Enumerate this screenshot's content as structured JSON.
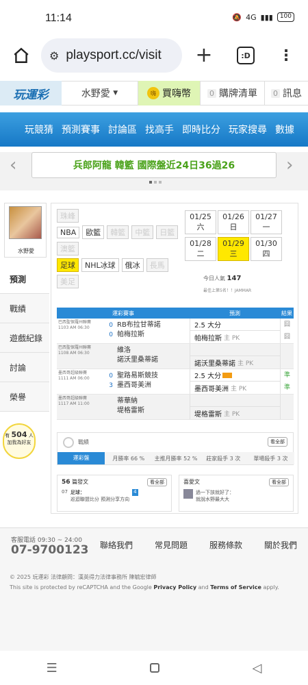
{
  "status": {
    "time": "11:14",
    "signal": "4G",
    "battery": "100"
  },
  "browser": {
    "url": "playsport.cc/visit",
    "tab_count": ":D"
  },
  "site": {
    "logo": "玩運彩",
    "user": "水野愛",
    "buy": "買嗨幣",
    "cart_count": "0",
    "cart": "購牌清單",
    "msg_count": "0",
    "msg": "訊息"
  },
  "nav": [
    "玩競猜",
    "預測賽事",
    "討論區",
    "找高手",
    "即時比分",
    "玩家搜尋",
    "數據"
  ],
  "marquee": {
    "text": "兵郎阿龍 韓籃 國際盤近24日36過26"
  },
  "profile": {
    "name": "水野愛"
  },
  "sidebar": [
    {
      "label": "預測"
    },
    {
      "label": "戰績"
    },
    {
      "label": "遊戲紀錄"
    },
    {
      "label": "討論"
    },
    {
      "label": "榮譽"
    }
  ],
  "bulb": {
    "pre": "有",
    "count": "504",
    "post": "人",
    "sub": "加我為好友"
  },
  "leagues": {
    "row1": [
      "珠峰",
      "NBA",
      "歐籃",
      "韓籃",
      "中籃",
      "日籃",
      "澳籃"
    ],
    "row2": [
      "足球",
      "NHL冰球",
      "俄冰",
      "長馬",
      "美足"
    ]
  },
  "dates": [
    {
      "d": "01/25",
      "w": "六"
    },
    {
      "d": "01/26",
      "w": "日"
    },
    {
      "d": "01/27",
      "w": "一"
    },
    {
      "d": "01/28",
      "w": "二"
    },
    {
      "d": "01/29",
      "w": "三"
    },
    {
      "d": "01/30",
      "w": "四"
    }
  ],
  "visits": {
    "label": "今日人氣",
    "value": "147",
    "rank": "最佳上第5名！！JAMMAR"
  },
  "table": {
    "head": [
      "運彩賽事",
      "預測",
      "結果"
    ],
    "rows": [
      {
        "league": "巴西聖保羅州聯賽",
        "time": "1103 AM 06:30",
        "home": "RB布拉甘蒂諾",
        "away": "帕梅拉斯",
        "hs": "0",
        "as": "0",
        "p1": "2.5 大分",
        "p2": "帕梅拉斯",
        "p2pk": "主 PK",
        "r1": "囧",
        "r2": "囧",
        "grey": false
      },
      {
        "league": "巴西聖保羅州聯賽",
        "time": "1108 AM 06:30",
        "home": "維洛",
        "away": "諾沃里桑蒂諾",
        "hs": "",
        "as": "",
        "p1": "",
        "p2": "諾沃里桑蒂諾",
        "p2pk": "主 PK",
        "r1": "",
        "r2": "",
        "grey": true
      },
      {
        "league": "墨西哥超級聯賽",
        "time": "1111 AM 06:00",
        "home": "聖路易斯競技",
        "away": "墨西哥美洲",
        "hs": "0",
        "as": "3",
        "p1": "2.5 大分",
        "p2": "墨西哥美洲",
        "p2pk": "主 PK",
        "r1": "準",
        "r2": "準",
        "grey": false
      },
      {
        "league": "墨西哥超級聯賽",
        "time": "1117 AM 11:00",
        "home": "蒂華納",
        "away": "堤格雷斯",
        "hs": "",
        "as": "",
        "p1": "",
        "p2": "堤格雷斯",
        "p2pk": "主 PK",
        "r1": "",
        "r2": "",
        "grey": true
      }
    ]
  },
  "stats": {
    "title": "戰績",
    "more": "看全部",
    "items": [
      "運彩盤",
      "月勝率 66 %",
      "主推月勝率 52 %",
      "莊家殺手 3 次",
      "單場殺手 3 次"
    ]
  },
  "posts": {
    "count": "56",
    "label": "篇發文",
    "more": "看全部",
    "item_date": "07",
    "item_title": "足球：",
    "item_sub": "巡迴聯盟比分 預測分享方向",
    "item_badge": "4"
  },
  "fav": {
    "label": "喜愛文",
    "more": "看全部",
    "item": "過一下該就好了：",
    "item_sub": "就說水野最大大"
  },
  "footer": {
    "phone_label": "客服電話 09:30 ~ 24:00",
    "phone": "07-9700123",
    "links": [
      "聯絡我們",
      "常見問題",
      "服務條款",
      "關於我們"
    ],
    "copy": "© 2025 玩運彩 法律顧問：漢英得力法律事務所 陳毓宏律師",
    "recap_a": "This site is protected by reCAPTCHA and the Google ",
    "recap_b": "Privacy Policy",
    "recap_c": " and ",
    "recap_d": "Terms of Service",
    "recap_e": " apply."
  }
}
